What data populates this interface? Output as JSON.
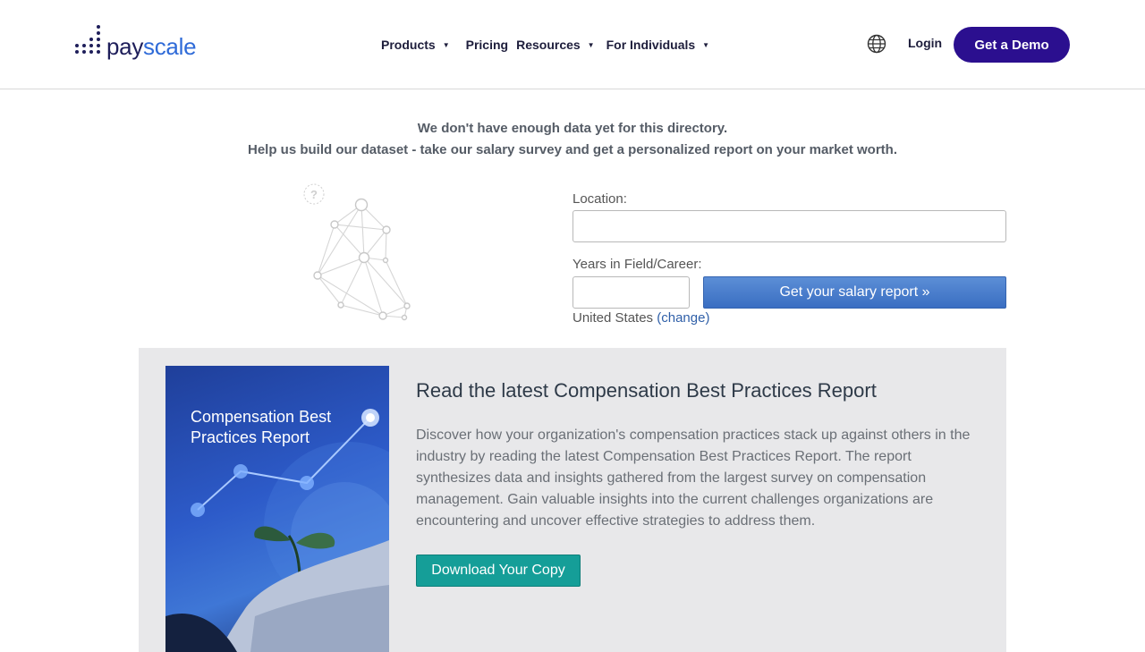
{
  "brand": {
    "name_part1": "pay",
    "name_part2": "scale",
    "primary_color": "#2b0f8f",
    "accent_color": "#2f6bd8"
  },
  "nav": {
    "items": [
      {
        "label": "Products",
        "has_dropdown": true
      },
      {
        "label": "Pricing",
        "has_dropdown": false
      },
      {
        "label": "Resources",
        "has_dropdown": true
      },
      {
        "label": "For Individuals",
        "has_dropdown": true
      }
    ],
    "caret": "▼"
  },
  "header": {
    "login_label": "Login",
    "demo_label": "Get a Demo",
    "language_icon": "globe-icon"
  },
  "notice": {
    "line1": "We don't have enough data yet for this directory.",
    "line2": "Help us build our dataset - take our salary survey and get a personalized report on your market worth."
  },
  "form": {
    "location_label": "Location:",
    "location_value": "",
    "years_label": "Years in Field/Career:",
    "years_value": "",
    "submit_label": "Get your salary report »",
    "country_text": "United States",
    "change_label": "(change)"
  },
  "promo": {
    "cover_title": "Compensation Best Practices Report",
    "title": "Read the latest Compensation Best Practices Report",
    "body": "Discover how your organization's compensation practices stack up against others in the industry by reading the latest Compensation Best Practices Report. The report synthesizes data and insights gathered from the largest survey on compensation management. Gain valuable insights into the current challenges organizations are encountering and uncover effective strategies to address them.",
    "button_label": "Download Your Copy",
    "button_color": "#159e98"
  }
}
